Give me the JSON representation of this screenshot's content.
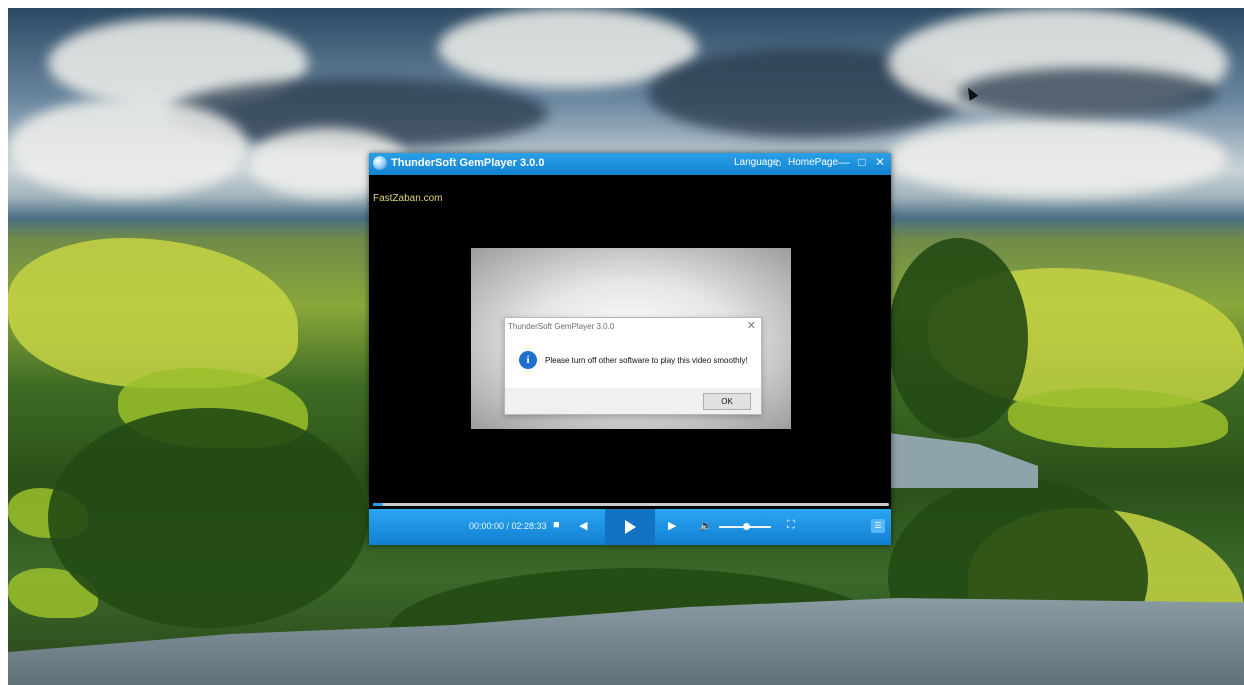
{
  "player": {
    "title": "ThunderSoft GemPlayer 3.0.0",
    "language_label": "Language",
    "homepage_label": "HomePage",
    "watermark": "FastZaban.com",
    "time_display": "00:00:00 / 02:28:33",
    "progress_fraction": 0.02,
    "volume_fraction": 0.52
  },
  "dialog": {
    "title": "ThunderSoft GemPlayer 3.0.0",
    "message": "Please turn off other software to play this video smoothly!",
    "ok_label": "OK"
  },
  "icons": {
    "app": "gemplayer-logo-icon",
    "home": "home-icon",
    "minimize": "minimize-icon",
    "maximize": "maximize-icon",
    "close": "close-icon",
    "info": "info-icon",
    "stop": "stop-icon",
    "prev": "previous-icon",
    "play": "play-icon",
    "next": "next-icon",
    "volume": "volume-icon",
    "fullscreen": "fullscreen-icon",
    "playlist": "playlist-icon"
  },
  "colors": {
    "accent": "#1182d0",
    "watermark": "#e0d77a"
  }
}
